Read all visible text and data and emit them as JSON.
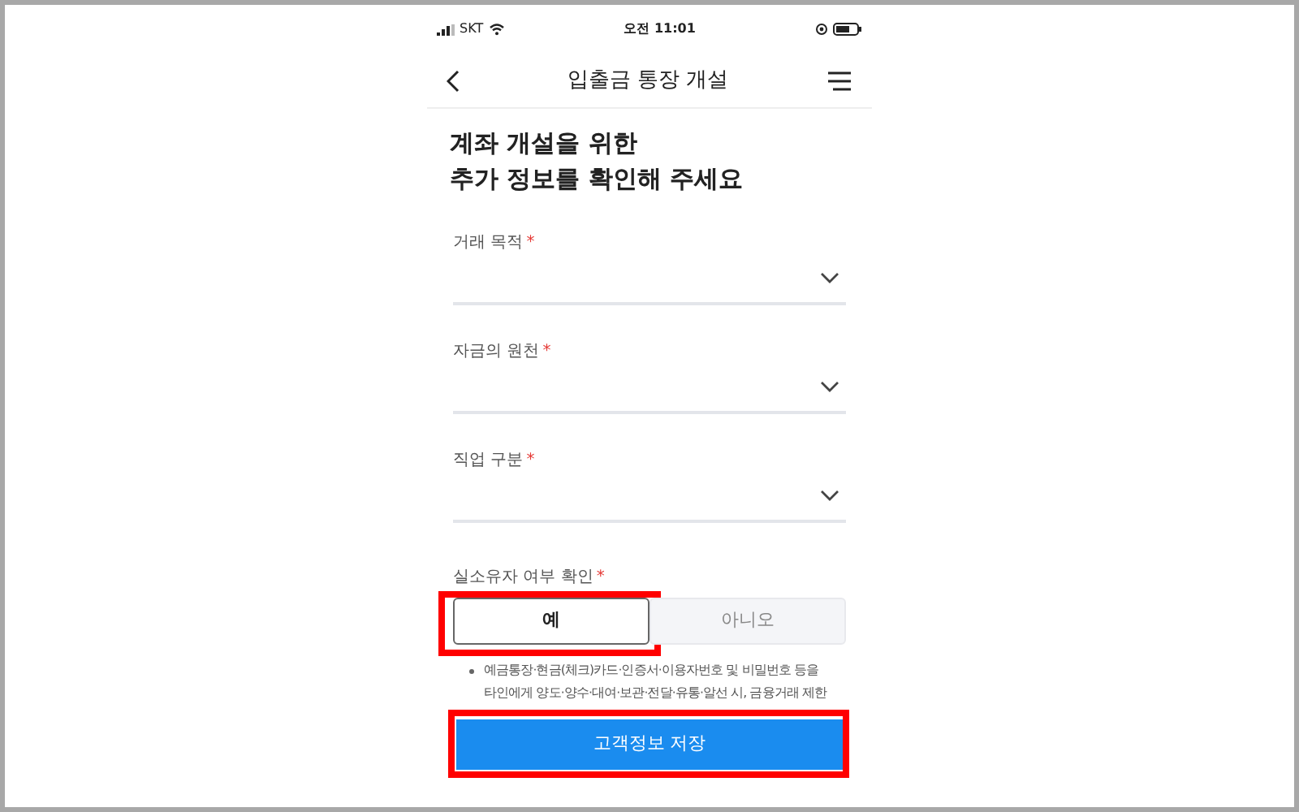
{
  "status_bar": {
    "carrier": "SKT",
    "time": "오전 11:01"
  },
  "header": {
    "title": "입출금 통장 개설"
  },
  "heading": [
    "계좌 개설을 위한",
    "추가 정보를 확인해 주세요"
  ],
  "fields": [
    {
      "label": "거래 목적",
      "required": "*"
    },
    {
      "label": "자금의 원천",
      "required": "*"
    },
    {
      "label": "직업 구분",
      "required": "*"
    }
  ],
  "owner_check": {
    "label": "실소유자 여부 확인",
    "required": "*",
    "options": [
      {
        "label": "예",
        "selected": true,
        "highlighted": true
      },
      {
        "label": "아니오",
        "selected": false,
        "highlighted": false
      }
    ]
  },
  "notice": "예금통장·현금(체크)카드·인증서·이용자번호 및 비밀번호 등을 타인에게 양도·양수·대여·보관·전달·유통·알선 시, 금융거래 제한",
  "save_button": {
    "label": "고객정보 저장",
    "highlighted": true
  }
}
